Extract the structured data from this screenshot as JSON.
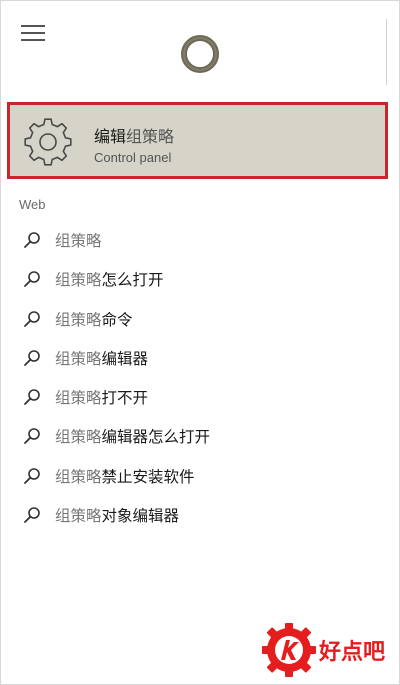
{
  "search": {
    "menu_icon": "hamburger-menu-icon",
    "assistant_icon": "cortana-ring-icon"
  },
  "best_match": {
    "icon": "gear-icon",
    "title_bold": "编辑",
    "title_rest": "组策略",
    "subtitle": "Control panel",
    "highlight_color": "#c7262b",
    "background_color": "#d6d3c8"
  },
  "web": {
    "section_label": "Web",
    "icon": "search-icon",
    "results": [
      {
        "query": "组策略",
        "rest": ""
      },
      {
        "query": "组策略",
        "rest": "怎么打开"
      },
      {
        "query": "组策略",
        "rest": "命令"
      },
      {
        "query": "组策略",
        "rest": "编辑器"
      },
      {
        "query": "组策略",
        "rest": "打不开"
      },
      {
        "query": "组策略",
        "rest": "编辑器怎么打开"
      },
      {
        "query": "组策略",
        "rest": "禁止安装软件"
      },
      {
        "query": "组策略",
        "rest": "对象编辑器"
      }
    ]
  },
  "watermark": {
    "logo_icon": "haodianba-logo-icon",
    "text": "好点吧",
    "color": "#e41d1f"
  }
}
